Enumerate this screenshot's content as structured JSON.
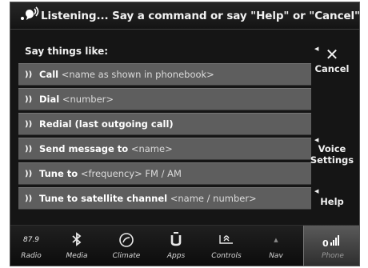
{
  "header": {
    "prompt": "Listening... Say a command or say \"Help\" or \"Cancel\""
  },
  "panel": {
    "title": "Say things like:",
    "commands": [
      {
        "command": "Call",
        "hint": "<name as shown in phonebook>"
      },
      {
        "command": "Dial",
        "hint": "<number>"
      },
      {
        "command": "Redial (last outgoing call)",
        "hint": ""
      },
      {
        "command": "Send message to",
        "hint": "<name>"
      },
      {
        "command": "Tune to",
        "hint": "<frequency> FM / AM"
      },
      {
        "command": "Tune to satellite channel",
        "hint": "<name / number>"
      }
    ]
  },
  "side": {
    "cancel_label": "Cancel",
    "voice_settings_line1": "Voice",
    "voice_settings_line2": "Settings",
    "help_label": "Help"
  },
  "nav": {
    "radio_freq": "87.9",
    "items": [
      {
        "label": "Radio",
        "icon": "radio-icon"
      },
      {
        "label": "Media",
        "icon": "bluetooth-icon"
      },
      {
        "label": "Climate",
        "icon": "climate-icon"
      },
      {
        "label": "Apps",
        "icon": "apps-icon"
      },
      {
        "label": "Controls",
        "icon": "controls-icon"
      },
      {
        "label": "Nav",
        "icon": "nav-icon"
      },
      {
        "label": "Phone",
        "icon": "phone-signal-icon"
      }
    ],
    "active": "Phone"
  },
  "colors": {
    "background": "#151515",
    "command_row": "#5e5e5e",
    "text": "#ffffff"
  }
}
